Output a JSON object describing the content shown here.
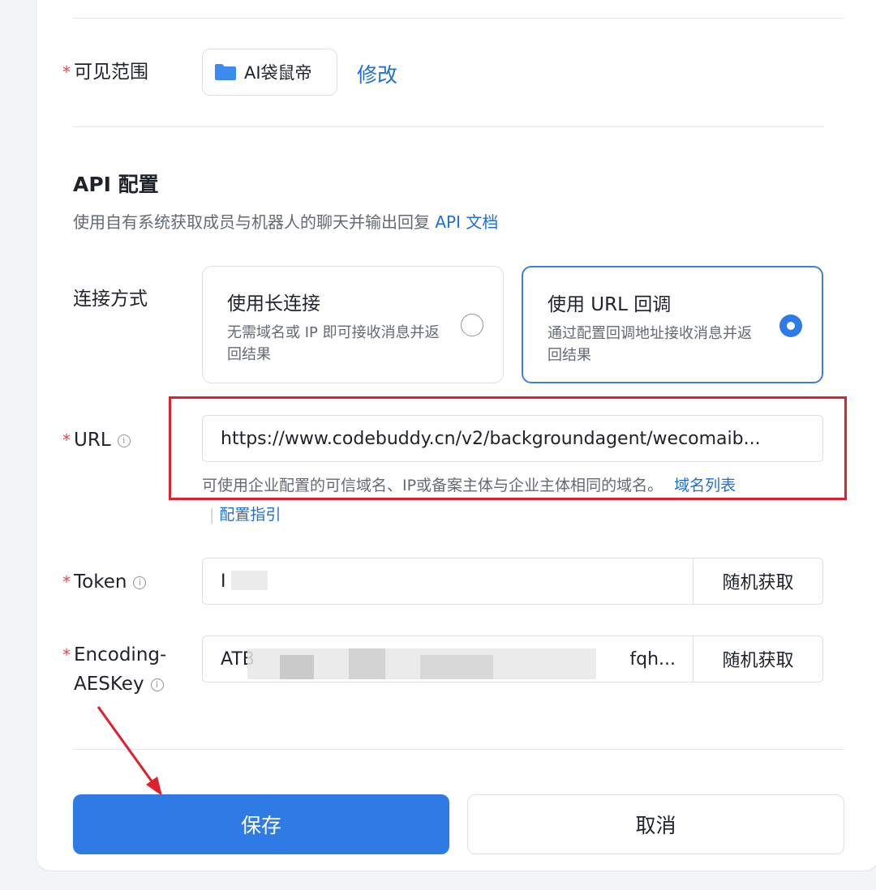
{
  "visibility": {
    "label": "可见范围",
    "scope_name": "AI袋鼠帝",
    "edit_label": "修改"
  },
  "api": {
    "title": "API 配置",
    "description": "使用自有系统获取成员与机器人的聊天并输出回复",
    "doc_link": "API 文档"
  },
  "connection": {
    "label": "连接方式",
    "options": [
      {
        "title": "使用长连接",
        "desc": "无需域名或 IP 即可接收消息并返回结果",
        "selected": false
      },
      {
        "title": "使用 URL 回调",
        "desc": "通过配置回调地址接收消息并返回结果",
        "selected": true
      }
    ]
  },
  "url": {
    "label": "URL",
    "value": "https://www.codebuddy.cn/v2/backgroundagent/wecomaib...",
    "hint": "可使用企业配置的可信域名、IP或备案主体与企业主体相同的域名。",
    "domain_list_link": "域名列表",
    "guide_link": "配置指引"
  },
  "token": {
    "label": "Token",
    "value": "I",
    "random_label": "随机获取"
  },
  "aes": {
    "label_line1": "Encoding-",
    "label_line2": "AESKey",
    "value_start": "ATB",
    "value_end": "fqh...",
    "random_label": "随机获取"
  },
  "actions": {
    "save": "保存",
    "cancel": "取消"
  },
  "colors": {
    "primary": "#2f7be5",
    "link": "#1f6fd6",
    "required": "#e5484d",
    "annotation_red": "#e0202a"
  }
}
